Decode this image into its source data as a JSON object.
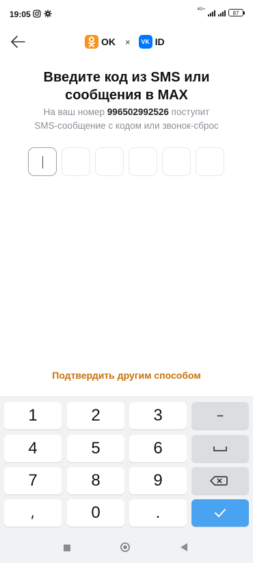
{
  "status_bar": {
    "time": "19:05",
    "network": "4G+",
    "battery": "87"
  },
  "header": {
    "ok_label": "OK",
    "times": "×",
    "vk_badge": "VK",
    "id_label": "ID",
    "back_icon": "arrow-left-icon"
  },
  "main": {
    "title_line1": "Введите код из SMS или",
    "title_line2": "сообщения в MAX",
    "subtitle_prefix": "На ваш номер",
    "phone_number": "996502992526",
    "subtitle_suffix": "поступит",
    "subtitle_line2": "SMS-сообщение с кодом или звонок-сброс",
    "code_length": 6,
    "alternate_link": "Подтвердить другим способом"
  },
  "keyboard": {
    "keys": [
      "1",
      "2",
      "3",
      "4",
      "5",
      "6",
      "7",
      "8",
      "9",
      "0",
      "."
    ],
    "minus": "−",
    "space_icon": "space-icon",
    "backspace_icon": "backspace-icon",
    "confirm_icon": "checkmark-icon"
  },
  "nav_bar": {
    "recents_icon": "square-icon",
    "home_icon": "circle-icon",
    "back_icon": "triangle-back-icon"
  },
  "colors": {
    "accent": "#c8700a",
    "ok_orange": "#f7931e",
    "vk_blue": "#0077ff",
    "confirm_blue": "#4aa3f0"
  }
}
